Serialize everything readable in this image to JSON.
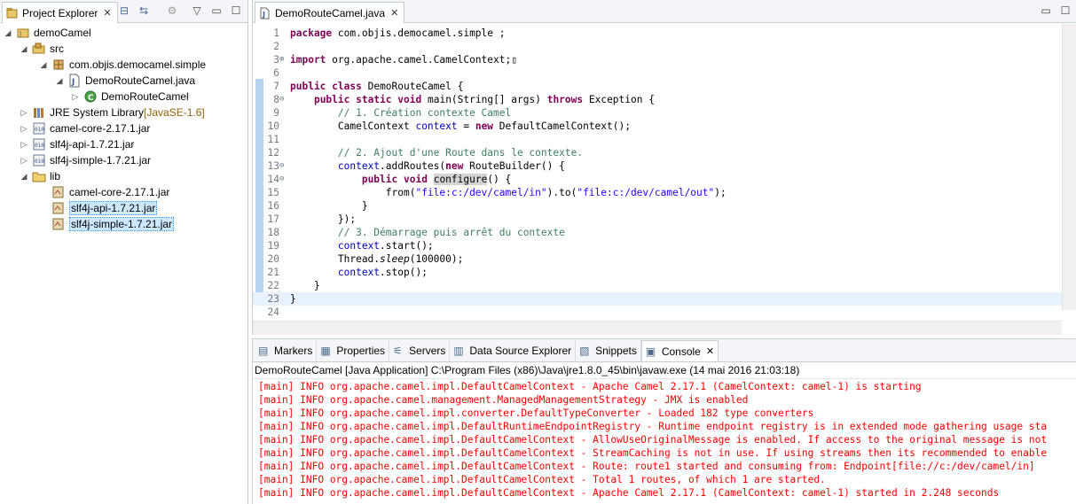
{
  "explorer": {
    "tab_label": "Project Explorer",
    "close_glyph": "✕",
    "tree": [
      {
        "label": "demoCamel",
        "suffix": "",
        "level": 0,
        "twisty": "◢",
        "icon": "java-project-icon"
      },
      {
        "label": "src",
        "suffix": "",
        "level": 1,
        "twisty": "◢",
        "icon": "source-folder-icon"
      },
      {
        "label": "com.objis.democamel.simple",
        "suffix": "",
        "level": 2,
        "twisty": "◢",
        "icon": "package-icon"
      },
      {
        "label": "DemoRouteCamel.java",
        "suffix": "",
        "level": 3,
        "twisty": "◢",
        "icon": "java-file-icon"
      },
      {
        "label": "DemoRouteCamel",
        "suffix": "",
        "level": 4,
        "twisty": "▷",
        "icon": "java-class-icon"
      },
      {
        "label": "JRE System Library",
        "suffix": " [JavaSE-1.6]",
        "level": 1,
        "twisty": "▷",
        "icon": "library-icon"
      },
      {
        "label": "camel-core-2.17.1.jar",
        "suffix": "",
        "level": 1,
        "twisty": "▷",
        "icon": "jar-icon"
      },
      {
        "label": "slf4j-api-1.7.21.jar",
        "suffix": "",
        "level": 1,
        "twisty": "▷",
        "icon": "jar-icon"
      },
      {
        "label": "slf4j-simple-1.7.21.jar",
        "suffix": "",
        "level": 1,
        "twisty": "▷",
        "icon": "jar-icon"
      },
      {
        "label": "lib",
        "suffix": "",
        "level": 1,
        "twisty": "◢",
        "icon": "folder-icon"
      },
      {
        "label": "camel-core-2.17.1.jar",
        "suffix": "",
        "level": 2,
        "twisty": "",
        "icon": "jar-file-icon"
      },
      {
        "label": "slf4j-api-1.7.21.jar",
        "suffix": "",
        "level": 2,
        "twisty": "",
        "icon": "jar-file-icon",
        "selected": true
      },
      {
        "label": "slf4j-simple-1.7.21.jar",
        "suffix": "",
        "level": 2,
        "twisty": "",
        "icon": "jar-file-icon",
        "selected": true
      }
    ]
  },
  "editor": {
    "tab_label": "DemoRouteCamel.java",
    "close_glyph": "✕",
    "lines": [
      {
        "n": "1",
        "fold": "",
        "html": "<span class='kw'>package</span> com.objis.democamel.simple ;"
      },
      {
        "n": "2",
        "fold": "",
        "html": ""
      },
      {
        "n": "3",
        "fold": "⊕",
        "html": "<span class='kw'>import</span> org.apache.camel.CamelContext;▯"
      },
      {
        "n": "6",
        "fold": "",
        "html": ""
      },
      {
        "n": "7",
        "fold": "",
        "html": "<span class='kw'>public</span> <span class='kw'>class</span> DemoRouteCamel {"
      },
      {
        "n": "8",
        "fold": "⊖",
        "html": "    <span class='kw'>public</span> <span class='kw'>static</span> <span class='kw'>void</span> main(String[] args) <span class='kw'>throws</span> Exception {"
      },
      {
        "n": "9",
        "fold": "",
        "html": "        <span class='cm'>// 1. Création contexte Camel</span>"
      },
      {
        "n": "10",
        "fold": "",
        "html": "        CamelContext <span class='fld'>context</span> = <span class='kw'>new</span> DefaultCamelContext();"
      },
      {
        "n": "11",
        "fold": "",
        "html": ""
      },
      {
        "n": "12",
        "fold": "",
        "html": "        <span class='cm'>// 2. Ajout d'une Route dans le contexte.</span>"
      },
      {
        "n": "13",
        "fold": "⊖",
        "html": "        <span class='fld'>context</span>.addRoutes(<span class='kw'>new</span> RouteBuilder() {"
      },
      {
        "n": "14",
        "fold": "⊖",
        "html": "            <span class='kw'>public</span> <span class='kw'>void</span> <span class='occ'>configure</span>() {"
      },
      {
        "n": "15",
        "fold": "",
        "html": "                from(<span class='st'>\"file:c:/dev/camel/in\"</span>).to(<span class='st'>\"file:c:/dev/camel/out\"</span>);"
      },
      {
        "n": "16",
        "fold": "",
        "html": "            }"
      },
      {
        "n": "17",
        "fold": "",
        "html": "        });"
      },
      {
        "n": "18",
        "fold": "",
        "html": "        <span class='cm'>// 3. Démarrage puis arrêt du contexte</span>"
      },
      {
        "n": "19",
        "fold": "",
        "html": "        <span class='fld'>context</span>.start();"
      },
      {
        "n": "20",
        "fold": "",
        "html": "        Thread.<span class='it'>sleep</span>(100000);"
      },
      {
        "n": "21",
        "fold": "",
        "html": "        <span class='fld'>context</span>.stop();"
      },
      {
        "n": "22",
        "fold": "",
        "html": "    }"
      },
      {
        "n": "23",
        "fold": "",
        "html": "}",
        "current": true
      },
      {
        "n": "24",
        "fold": "",
        "html": ""
      }
    ]
  },
  "console": {
    "tabs": [
      {
        "label": "Markers",
        "icon": "markers-icon"
      },
      {
        "label": "Properties",
        "icon": "properties-icon"
      },
      {
        "label": "Servers",
        "icon": "servers-icon"
      },
      {
        "label": "Data Source Explorer",
        "icon": "data-source-icon"
      },
      {
        "label": "Snippets",
        "icon": "snippets-icon"
      },
      {
        "label": "Console",
        "icon": "console-icon",
        "active": true
      }
    ],
    "close_glyph": "✕",
    "title": "DemoRouteCamel [Java Application] C:\\Program Files (x86)\\Java\\jre1.8.0_45\\bin\\javaw.exe (14 mai 2016 21:03:18)",
    "lines": [
      "[main] INFO org.apache.camel.impl.DefaultCamelContext - Apache Camel 2.17.1 (CamelContext: camel-1) is starting",
      "[main] INFO org.apache.camel.management.ManagedManagementStrategy - JMX is enabled",
      "[main] INFO org.apache.camel.impl.converter.DefaultTypeConverter - Loaded 182 type converters",
      "[main] INFO org.apache.camel.impl.DefaultRuntimeEndpointRegistry - Runtime endpoint registry is in extended mode gathering usage sta",
      "[main] INFO org.apache.camel.impl.DefaultCamelContext - AllowUseOriginalMessage is enabled. If access to the original message is not",
      "[main] INFO org.apache.camel.impl.DefaultCamelContext - StreamCaching is not in use. If using streams then its recommended to enable",
      "[main] INFO org.apache.camel.impl.DefaultCamelContext - Route: route1 started and consuming from: Endpoint[file://c:/dev/camel/in]",
      "[main] INFO org.apache.camel.impl.DefaultCamelContext - Total 1 routes, of which 1 are started.",
      "[main] INFO org.apache.camel.impl.DefaultCamelContext - Apache Camel 2.17.1 (CamelContext: camel-1) started in 2.248 seconds"
    ]
  }
}
